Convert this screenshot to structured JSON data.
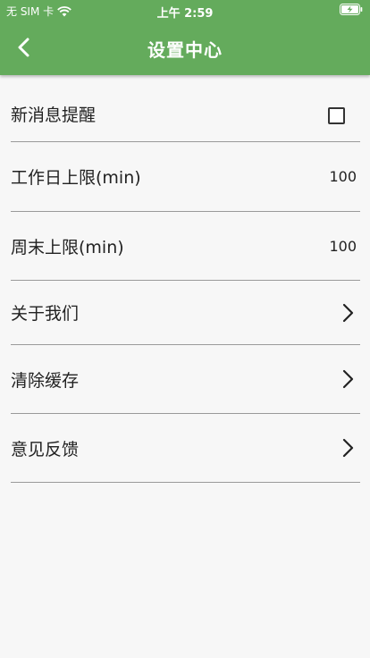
{
  "status_bar": {
    "carrier": "无 SIM 卡",
    "time": "上午 2:59"
  },
  "nav": {
    "title": "设置中心",
    "back_icon": "chevron-left-icon"
  },
  "settings": {
    "new_message_reminder": {
      "label": "新消息提醒",
      "checked": false
    },
    "weekday_limit": {
      "label": "工作日上限(min)",
      "value": "100"
    },
    "weekend_limit": {
      "label": "周末上限(min)",
      "value": "100"
    },
    "about_us": {
      "label": "关于我们"
    },
    "clear_cache": {
      "label": "清除缓存"
    },
    "feedback": {
      "label": "意见反馈"
    }
  },
  "colors": {
    "header": "#64ab5c",
    "background": "#f7f7f7",
    "divider": "#9a9a9a",
    "text": "#222222"
  }
}
